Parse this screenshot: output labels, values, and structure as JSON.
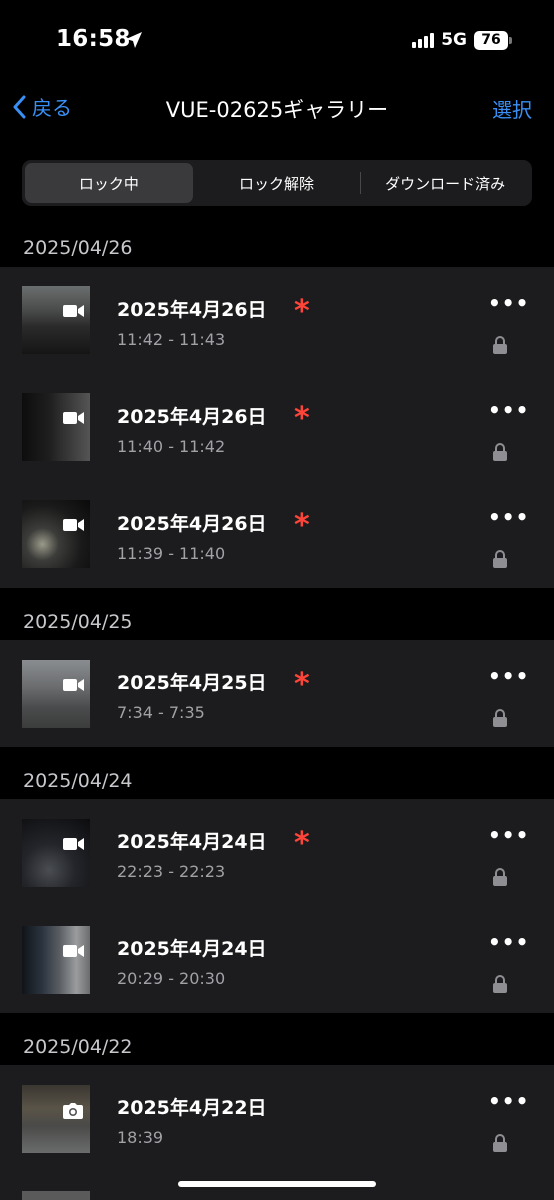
{
  "status_bar": {
    "time": "16:58",
    "network": "5G",
    "battery": "76"
  },
  "nav": {
    "back_label": "戻る",
    "title": "VUE-02625ギャラリー",
    "select_label": "選択"
  },
  "tabs": [
    {
      "label": "ロック中",
      "active": true
    },
    {
      "label": "ロック解除",
      "active": false
    },
    {
      "label": "ダウンロード済み",
      "active": false
    }
  ],
  "sections": [
    {
      "header": "2025/04/26",
      "items": [
        {
          "title": "2025年4月26日",
          "time": "11:42 - 11:43",
          "type": "video",
          "flagged": true,
          "locked": true
        },
        {
          "title": "2025年4月26日",
          "time": "11:40 - 11:42",
          "type": "video",
          "flagged": true,
          "locked": true
        },
        {
          "title": "2025年4月26日",
          "time": "11:39 - 11:40",
          "type": "video",
          "flagged": true,
          "locked": true
        }
      ]
    },
    {
      "header": "2025/04/25",
      "items": [
        {
          "title": "2025年4月25日",
          "time": "7:34 - 7:35",
          "type": "video",
          "flagged": true,
          "locked": true
        }
      ]
    },
    {
      "header": "2025/04/24",
      "items": [
        {
          "title": "2025年4月24日",
          "time": "22:23 - 22:23",
          "type": "video",
          "flagged": true,
          "locked": true
        },
        {
          "title": "2025年4月24日",
          "time": "20:29 - 20:30",
          "type": "video",
          "flagged": false,
          "locked": true
        }
      ]
    },
    {
      "header": "2025/04/22",
      "items": [
        {
          "title": "2025年4月22日",
          "time": "18:39",
          "type": "photo",
          "flagged": false,
          "locked": true
        }
      ]
    }
  ],
  "glyphs": {
    "more": "•••",
    "flag": "*"
  },
  "colors": {
    "accent": "#3a8ff5",
    "flag": "#ff453a",
    "row_bg": "#1c1c1e"
  }
}
